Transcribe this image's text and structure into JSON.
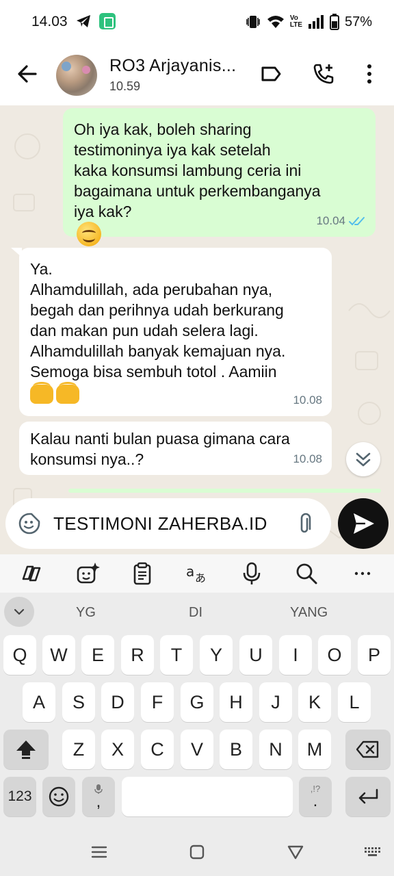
{
  "status_bar": {
    "time": "14.03",
    "battery": "57%",
    "lte_label_top": "Vo",
    "lte_label_bottom": "LTE"
  },
  "header": {
    "contact_name": "RO3 Arjayanis...",
    "last_seen": "10.59",
    "icons": [
      "back-arrow-icon",
      "label-tag-icon",
      "add-call-icon",
      "more-vert-icon"
    ]
  },
  "messages": [
    {
      "direction": "outgoing",
      "text": "Oh iya kak, boleh sharing\ntestimoninya iya kak setelah\nkaka konsumsi lambung ceria ini\nbagaimana untuk perkembanganya\niya kak?",
      "emoji": "smiling-face-icon",
      "time": "10.04",
      "status": "read"
    },
    {
      "direction": "incoming",
      "text": "Ya.\nAlhamdulillah, ada perubahan nya,\nbegah dan perihnya udah berkurang\ndan makan pun udah selera lagi.\nAlhamdulillah banyak kemajuan nya.\nSemoga bisa sembuh totol . Aamiin",
      "emoji": "palms-up-together-icon",
      "time": "10.08"
    },
    {
      "direction": "incoming",
      "text": "Kalau nanti bulan puasa gimana cara\nkonsumsi nya..?",
      "time": "10.08"
    }
  ],
  "compose": {
    "value": "TESTIMONI ZAHERBA.ID"
  },
  "keyboard": {
    "suggestions": [
      "YG",
      "DI",
      "YANG"
    ],
    "row1": [
      "Q",
      "W",
      "E",
      "R",
      "T",
      "Y",
      "U",
      "I",
      "O",
      "P"
    ],
    "row2": [
      "A",
      "S",
      "D",
      "F",
      "G",
      "H",
      "J",
      "K",
      "L"
    ],
    "row3": [
      "Z",
      "X",
      "C",
      "V",
      "B",
      "N",
      "M"
    ],
    "numbers_key": "123",
    "comma_key": ",",
    "period_key": ".",
    "punct_hint": ",!?"
  },
  "colors": {
    "outgoing_bubble": "#d9fdd3",
    "incoming_bubble": "#ffffff",
    "chat_background": "#efeae2",
    "read_ticks": "#53bdeb",
    "send_button": "#111111"
  }
}
